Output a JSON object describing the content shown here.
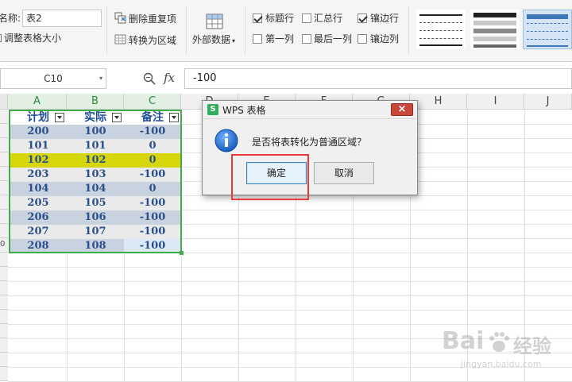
{
  "ribbon": {
    "table_name_label": "名称:",
    "table_name_value": "表2",
    "resize_table": "调整表格大小",
    "remove_duplicates": "删除重复项",
    "convert_to_range": "转换为区域",
    "external_data": "外部数据",
    "options": {
      "header_row": {
        "label": "标题行",
        "checked": true
      },
      "total_row": {
        "label": "汇总行",
        "checked": false
      },
      "banded_rows": {
        "label": "镶边行",
        "checked": true
      },
      "first_column": {
        "label": "第一列",
        "checked": false
      },
      "last_column": {
        "label": "最后一列",
        "checked": false
      },
      "banded_columns": {
        "label": "镶边列",
        "checked": false
      }
    }
  },
  "formula_bar": {
    "cell_ref": "C10",
    "fx_label": "fx",
    "formula": "-100"
  },
  "columns": [
    "A",
    "B",
    "C",
    "D",
    "E",
    "F",
    "G",
    "H",
    "I",
    "J"
  ],
  "row_labels": {
    "last_visible": "0"
  },
  "table": {
    "headers": [
      "计划",
      "实际",
      "备注"
    ],
    "rows": [
      [
        "200",
        "100",
        "-100"
      ],
      [
        "101",
        "101",
        "0"
      ],
      [
        "102",
        "102",
        "0"
      ],
      [
        "203",
        "103",
        "-100"
      ],
      [
        "104",
        "104",
        "0"
      ],
      [
        "205",
        "105",
        "-100"
      ],
      [
        "206",
        "106",
        "-100"
      ],
      [
        "207",
        "107",
        "-100"
      ],
      [
        "208",
        "108",
        "-100"
      ]
    ],
    "highlight_row_index": 2,
    "colors": {
      "band": "#c9d3df",
      "plain": "#eaeaea",
      "highlight": "#d6d60a",
      "selected_cell": "#dbe8f5",
      "border": "#3fae49",
      "text": "#2a4f8a"
    }
  },
  "dialog": {
    "title": "WPS 表格",
    "message": "是否将表转化为普通区域？",
    "ok": "确定",
    "cancel": "取消",
    "close": "×"
  },
  "watermark": {
    "brand": "Bai",
    "brand2": "经验",
    "url": "jingyan.baidu.com"
  }
}
